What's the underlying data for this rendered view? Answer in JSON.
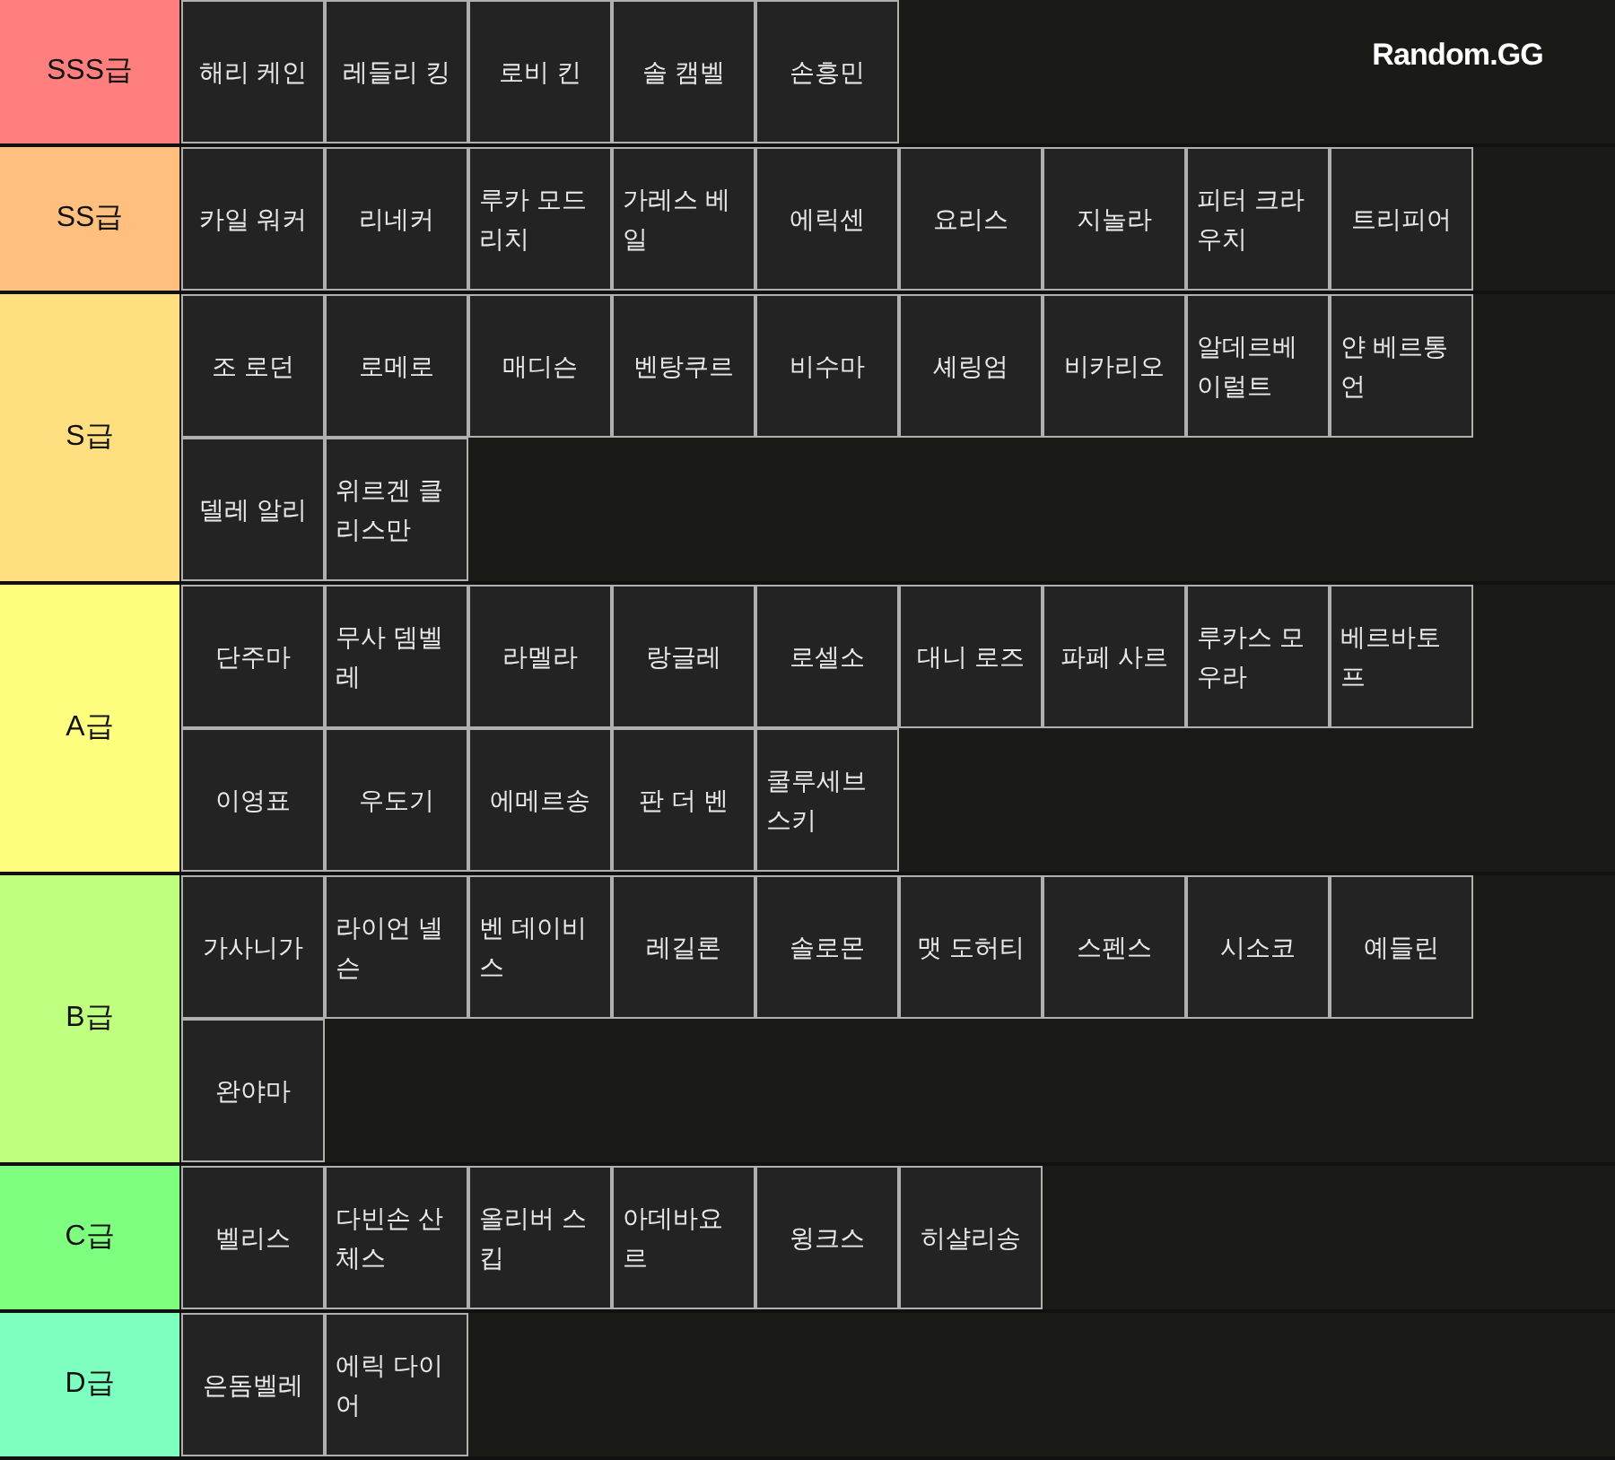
{
  "logo": "Random.GG",
  "tiers": [
    {
      "label": "SSS급",
      "color": "#ff7f7f",
      "items": [
        "해리 케인",
        "레들리 킹",
        "로비 킨",
        "솔 캠벨",
        "손흥민"
      ]
    },
    {
      "label": "SS급",
      "color": "#ffbf7f",
      "items": [
        "카일 워커",
        "리네커",
        "루카 모드리치",
        "가레스 베일",
        "에릭센",
        "요리스",
        "지놀라",
        "피터 크라우치",
        "트리피어"
      ]
    },
    {
      "label": "S급",
      "color": "#ffdf7f",
      "items": [
        "조 로던",
        "로메로",
        "매디슨",
        "벤탕쿠르",
        "비수마",
        "셰링엄",
        "비카리오",
        "알데르베이럴트",
        "얀 베르통언",
        "델레 알리",
        "위르겐 클리스만"
      ]
    },
    {
      "label": "A급",
      "color": "#ffff7f",
      "items": [
        "단주마",
        "무사 뎀벨레",
        "라멜라",
        "랑글레",
        "로셀소",
        "대니 로즈",
        "파페 사르",
        "루카스 모우라",
        "베르바토프",
        "이영표",
        "우도기",
        "에메르송",
        "판 더 벤",
        "쿨루세브스키"
      ]
    },
    {
      "label": "B급",
      "color": "#bfff7f",
      "items": [
        "가사니가",
        "라이언 넬슨",
        "벤 데이비스",
        "레길론",
        "솔로몬",
        "맷 도허티",
        "스펜스",
        "시소코",
        "예들린",
        "완야마"
      ]
    },
    {
      "label": "C급",
      "color": "#7fff7f",
      "items": [
        "벨리스",
        "다빈손 산체스",
        "올리버 스킵",
        "아데바요르",
        "윙크스",
        "히샬리송"
      ]
    },
    {
      "label": "D급",
      "color": "#7fffbf",
      "items": [
        "은돔벨레",
        "에릭 다이어"
      ]
    }
  ]
}
